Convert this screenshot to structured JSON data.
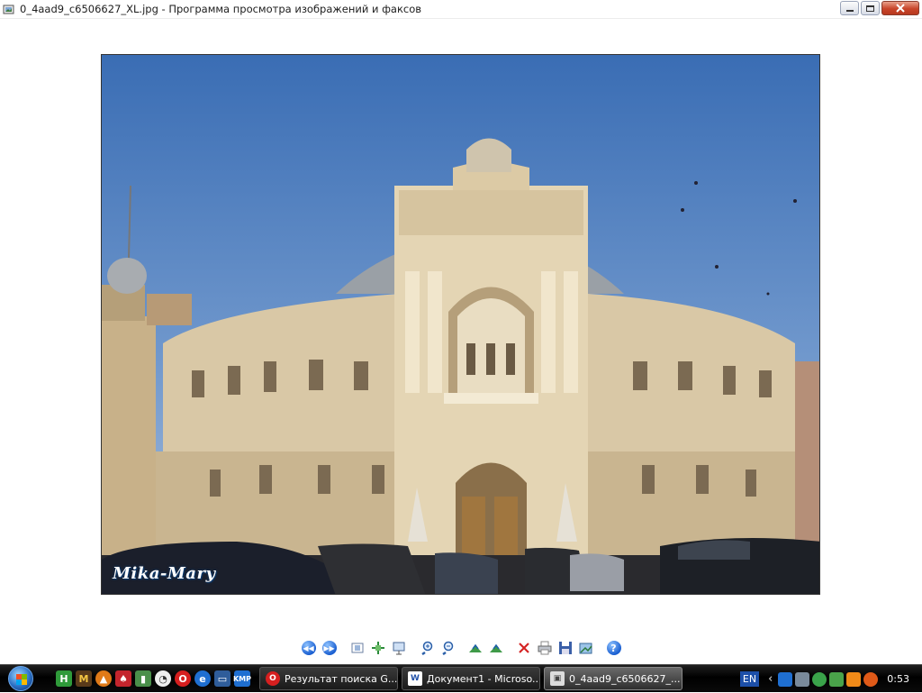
{
  "window": {
    "title": "0_4aad9_c6506627_XL.jpg - Программа просмотра изображений и факсов"
  },
  "photo": {
    "watermark": "Mika-Mary"
  },
  "toolbar": {
    "buttons": [
      {
        "name": "previous-image-icon"
      },
      {
        "name": "next-image-icon"
      },
      {
        "name": "best-fit-icon"
      },
      {
        "name": "actual-size-icon"
      },
      {
        "name": "slideshow-icon"
      },
      {
        "name": "zoom-in-icon"
      },
      {
        "name": "zoom-out-icon"
      },
      {
        "name": "rotate-clockwise-icon"
      },
      {
        "name": "rotate-counterclockwise-icon"
      },
      {
        "name": "delete-icon"
      },
      {
        "name": "print-icon"
      },
      {
        "name": "save-icon"
      },
      {
        "name": "edit-icon"
      },
      {
        "name": "help-icon"
      }
    ]
  },
  "taskbar": {
    "tasks": [
      {
        "label": "Результат поиска G...",
        "icon": "opera-icon",
        "active": false
      },
      {
        "label": "Документ1 - Microso...",
        "icon": "word-icon",
        "active": false
      },
      {
        "label": "0_4aad9_c6506627_...",
        "icon": "image-viewer-icon",
        "active": true
      }
    ],
    "language": "EN",
    "clock": "0:53"
  }
}
